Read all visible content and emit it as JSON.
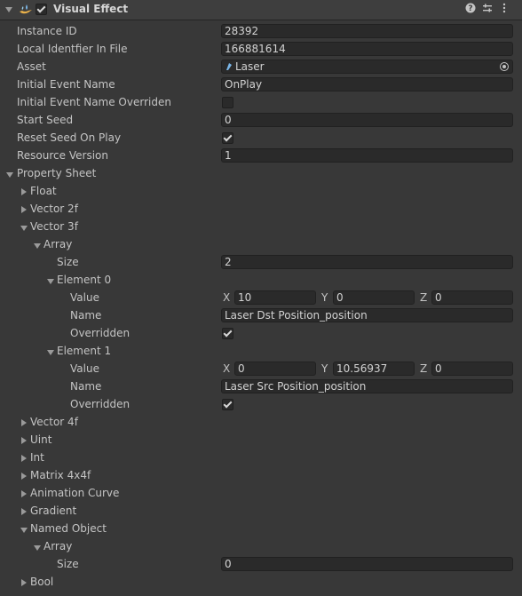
{
  "component": {
    "title": "Visual Effect",
    "enabled": true,
    "help_icon": "help-icon",
    "preset_icon": "preset-icon",
    "menu_icon": "kebab-menu-icon"
  },
  "fields": {
    "instance_id": {
      "label": "Instance ID",
      "value": "28392"
    },
    "local_identifier": {
      "label": "Local Identfier In File",
      "value": "166881614"
    },
    "asset": {
      "label": "Asset",
      "value": "Laser"
    },
    "initial_event_name": {
      "label": "Initial Event Name",
      "value": "OnPlay"
    },
    "initial_event_overriden": {
      "label": "Initial Event Name Overriden",
      "checked": false
    },
    "start_seed": {
      "label": "Start Seed",
      "value": "0"
    },
    "reset_seed": {
      "label": "Reset Seed On Play",
      "checked": true
    },
    "resource_version": {
      "label": "Resource Version",
      "value": "1"
    }
  },
  "property_sheet": {
    "label": "Property Sheet",
    "float": "Float",
    "vector2f": "Vector 2f",
    "vector3f": {
      "label": "Vector 3f",
      "array": "Array",
      "size_label": "Size",
      "size": "2",
      "elements": [
        {
          "label": "Element 0",
          "value_label": "Value",
          "x": "10",
          "y": "0",
          "z": "0",
          "name_label": "Name",
          "name": "Laser Dst Position_position",
          "overridden_label": "Overridden",
          "overridden": true
        },
        {
          "label": "Element 1",
          "value_label": "Value",
          "x": "0",
          "y": "10.56937",
          "z": "0",
          "name_label": "Name",
          "name": "Laser Src Position_position",
          "overridden_label": "Overridden",
          "overridden": true
        }
      ]
    },
    "vector4f": "Vector 4f",
    "uint": "Uint",
    "int": "Int",
    "matrix": "Matrix 4x4f",
    "animation_curve": "Animation Curve",
    "gradient": "Gradient",
    "named_object": {
      "label": "Named Object",
      "array": "Array",
      "size_label": "Size",
      "size": "0"
    },
    "bool": "Bool"
  },
  "axes": {
    "x": "X",
    "y": "Y",
    "z": "Z"
  }
}
